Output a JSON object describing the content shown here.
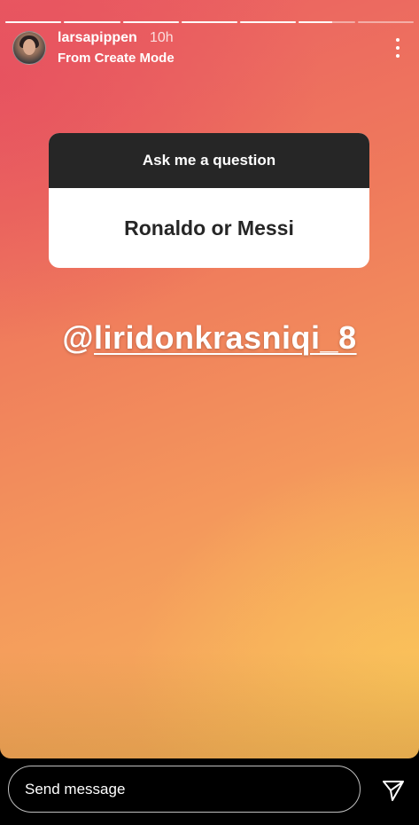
{
  "story": {
    "progress_segments": [
      1,
      1,
      1,
      1,
      1,
      0.6,
      0
    ],
    "username": "larsapippen",
    "time": "10h",
    "subtitle": "From Create Mode"
  },
  "question_sticker": {
    "header": "Ask me a question",
    "answer": "Ronaldo or Messi"
  },
  "mention": {
    "at": "@",
    "handle": "liridonkrasniqi_8"
  },
  "footer": {
    "send_placeholder": "Send message"
  },
  "icons": {
    "more": "vertical-ellipsis-icon",
    "send": "paper-plane-icon"
  }
}
